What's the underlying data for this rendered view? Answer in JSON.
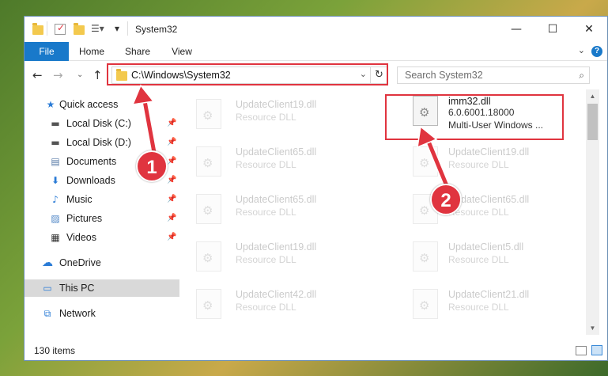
{
  "window": {
    "title": "System32",
    "controls": {
      "minimize": "—",
      "maximize": "☐",
      "close": "✕"
    }
  },
  "ribbon": {
    "tabs": [
      "File",
      "Home",
      "Share",
      "View"
    ],
    "help": "?"
  },
  "address_bar": {
    "path": "C:\\Windows\\System32",
    "search_placeholder": "Search System32"
  },
  "sidebar": {
    "quick_access": "Quick access",
    "items": [
      {
        "label": "Local Disk (C:)",
        "icon": "drive-icon",
        "pinned": true
      },
      {
        "label": "Local Disk (D:)",
        "icon": "drive-icon",
        "pinned": true
      },
      {
        "label": "Documents",
        "icon": "documents-icon",
        "pinned": true
      },
      {
        "label": "Downloads",
        "icon": "download-icon",
        "pinned": true
      },
      {
        "label": "Music",
        "icon": "music-icon",
        "pinned": true
      },
      {
        "label": "Pictures",
        "icon": "pictures-icon",
        "pinned": true
      },
      {
        "label": "Videos",
        "icon": "videos-icon",
        "pinned": true
      }
    ],
    "onedrive": "OneDrive",
    "this_pc": "This PC",
    "network": "Network"
  },
  "files": {
    "left_column": [
      {
        "name": "UpdateClient19.dll",
        "type": "Resource DLL"
      },
      {
        "name": "UpdateClient65.dll",
        "type": "Resource DLL"
      },
      {
        "name": "UpdateClient65.dll",
        "type": "Resource DLL"
      },
      {
        "name": "UpdateClient19.dll",
        "type": "Resource DLL"
      },
      {
        "name": "UpdateClient42.dll",
        "type": "Resource DLL"
      }
    ],
    "highlighted": {
      "name": "imm32.dll",
      "version": "6.0.6001.18000",
      "description": "Multi-User Windows ..."
    },
    "right_column": [
      {
        "name": "UpdateClient19.dll",
        "type": "Resource DLL"
      },
      {
        "name": "UpdateClient65.dll",
        "type": "Resource DLL"
      },
      {
        "name": "UpdateClient5.dll",
        "type": "Resource DLL"
      },
      {
        "name": "UpdateClient21.dll",
        "type": "Resource DLL"
      }
    ]
  },
  "status": {
    "item_count": "130 items"
  },
  "annotations": {
    "step1": "1",
    "step2": "2",
    "color": "#e0343f"
  }
}
